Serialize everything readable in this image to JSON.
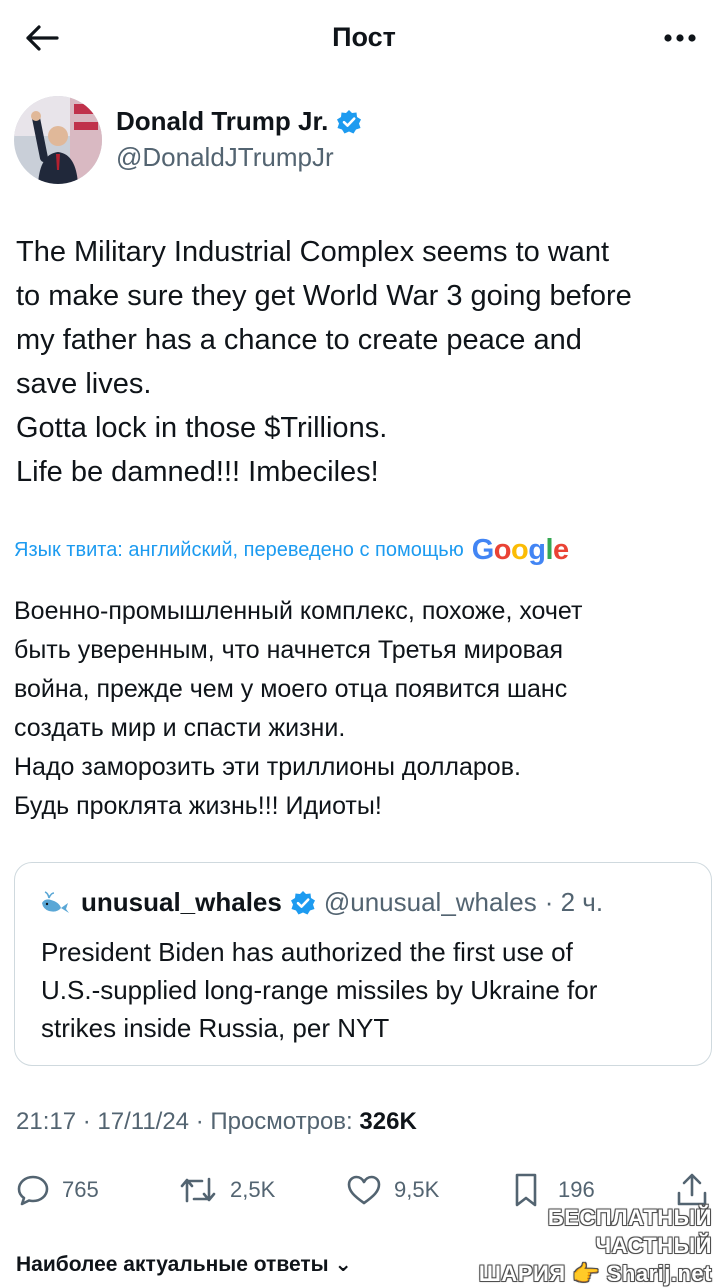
{
  "header": {
    "title": "Пост"
  },
  "author": {
    "name": "Donald Trump Jr.",
    "handle": "@DonaldJTrumpJr"
  },
  "tweet": {
    "lines": [
      "The Military Industrial Complex seems to want",
      "to make sure they get World War 3 going before",
      "my father has a chance to create peace and",
      "save lives.",
      "Gotta lock in those $Trillions.",
      "Life be damned!!! Imbeciles!"
    ]
  },
  "translation": {
    "note": "Язык твита: английский, переведено с помощью",
    "provider": "Google",
    "lines": [
      "Военно-промышленный комплекс, похоже, хочет",
      "быть уверенным, что начнется Третья мировая",
      "война, прежде чем у моего отца появится шанс",
      "создать мир и спасти жизни.",
      "Надо заморозить эти триллионы долларов.",
      "Будь проклята жизнь!!! Идиоты!"
    ]
  },
  "quote": {
    "name": "unusual_whales",
    "handle": "@unusual_whales",
    "time": "· 2 ч.",
    "lines": [
      "President Biden has authorized the first use of",
      "U.S.-supplied long-range missiles by Ukraine for",
      "strikes inside Russia, per NYT"
    ]
  },
  "meta": {
    "timestamp": "21:17 · 17/11/24 · Просмотров:",
    "views": "326K"
  },
  "actions": {
    "replies": "765",
    "reposts": "2,5K",
    "likes": "9,5K",
    "bookmarks": "196"
  },
  "watermark": {
    "line1": "БЕСПЛАТНЫЙ ЧАСТНЫЙ",
    "line2": "ШАРИЯ 👉 Sharij.net"
  },
  "more_replies": "Наиболее актуальные ответы ⌄",
  "colors": {
    "accent": "#1d9bf0",
    "secondary_text": "#536471",
    "border": "#cfd9de"
  }
}
